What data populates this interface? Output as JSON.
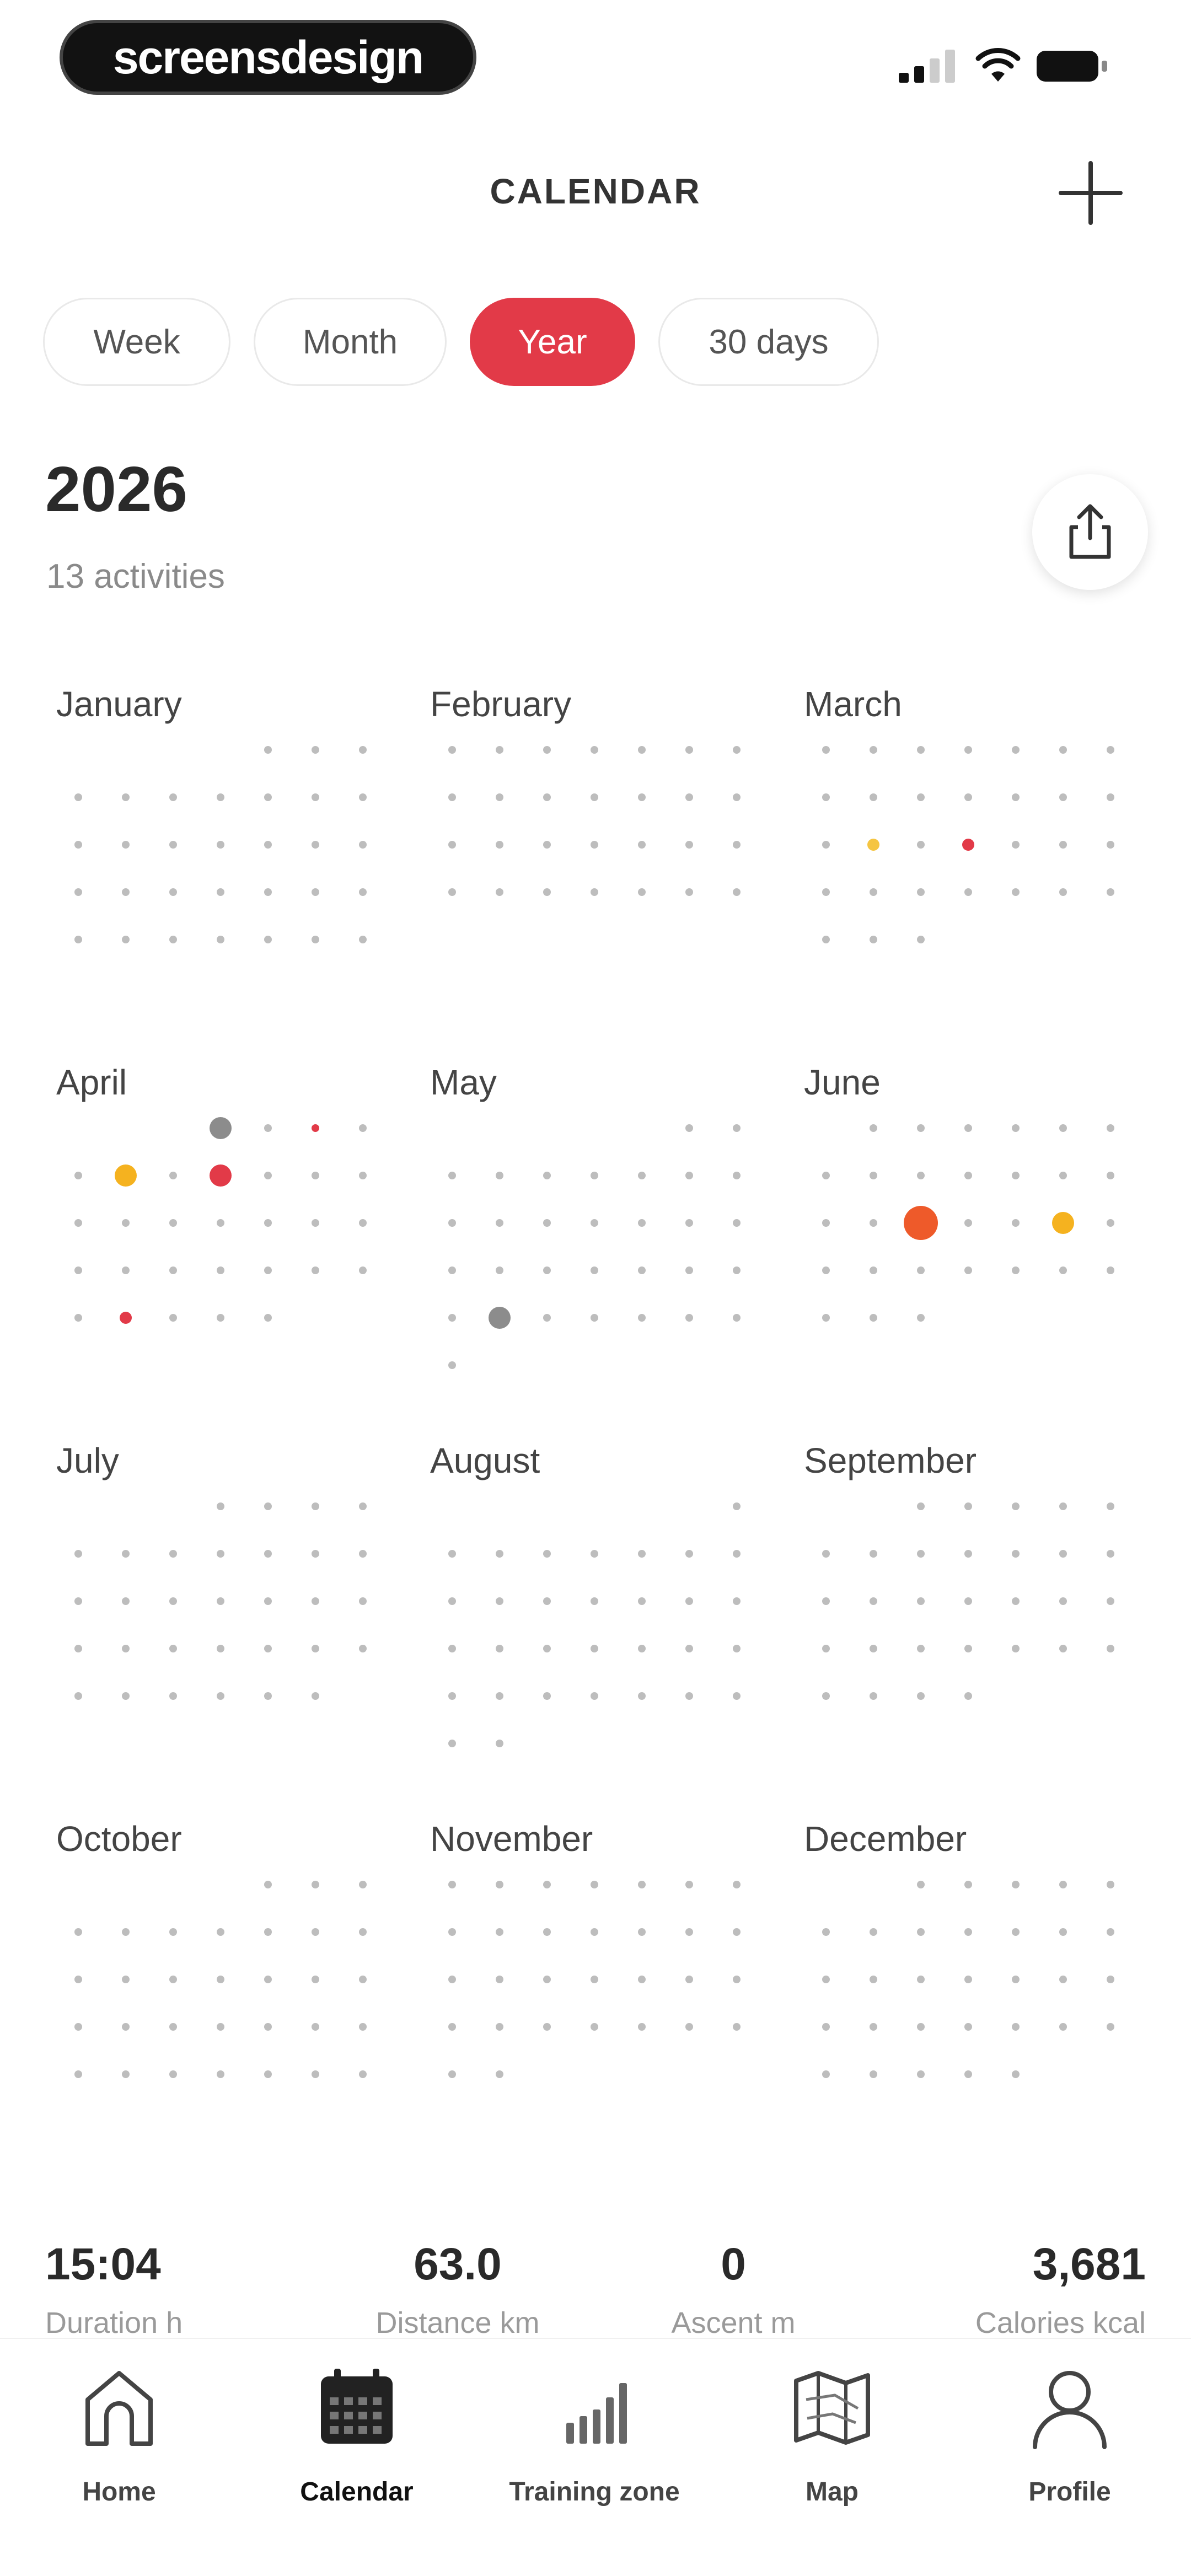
{
  "status_bar": {
    "brand": "screensdesign"
  },
  "header": {
    "title": "CALENDAR"
  },
  "tabs": [
    {
      "label": "Week",
      "active": false
    },
    {
      "label": "Month",
      "active": false
    },
    {
      "label": "Year",
      "active": true
    },
    {
      "label": "30 days",
      "active": false
    }
  ],
  "year": {
    "title": "2026",
    "activities": "13 activities"
  },
  "months": [
    {
      "name": "January",
      "days": 31,
      "offset": 4,
      "activities": []
    },
    {
      "name": "February",
      "days": 28,
      "offset": 0,
      "activities": []
    },
    {
      "name": "March",
      "days": 31,
      "offset": 0,
      "activities": [
        {
          "day": 16,
          "color": "#f5c542",
          "size": "small"
        },
        {
          "day": 18,
          "color": "#e23a48",
          "size": "small"
        }
      ]
    },
    {
      "name": "April",
      "days": 30,
      "offset": 3,
      "activities": [
        {
          "day": 1,
          "color": "#8c8c8c",
          "size": "medium"
        },
        {
          "day": 3,
          "color": "#e23a48",
          "size": "tiny"
        },
        {
          "day": 6,
          "color": "#f5b21f",
          "size": "medium"
        },
        {
          "day": 8,
          "color": "#e23a48",
          "size": "medium"
        },
        {
          "day": 27,
          "color": "#e23a48",
          "size": "small"
        }
      ]
    },
    {
      "name": "May",
      "days": 31,
      "offset": 5,
      "activities": [
        {
          "day": 25,
          "color": "#8c8c8c",
          "size": "medium"
        }
      ]
    },
    {
      "name": "June",
      "days": 30,
      "offset": 1,
      "activities": [
        {
          "day": 16,
          "color": "#ee5a2a",
          "size": "large"
        },
        {
          "day": 19,
          "color": "#f5b21f",
          "size": "medium"
        }
      ]
    },
    {
      "name": "July",
      "days": 31,
      "offset": 3,
      "activities": []
    },
    {
      "name": "August",
      "days": 31,
      "offset": 6,
      "activities": []
    },
    {
      "name": "September",
      "days": 30,
      "offset": 2,
      "activities": []
    },
    {
      "name": "October",
      "days": 31,
      "offset": 4,
      "activities": []
    },
    {
      "name": "November",
      "days": 30,
      "offset": 0,
      "activities": []
    },
    {
      "name": "December",
      "days": 31,
      "offset": 2,
      "activities": []
    }
  ],
  "stats": [
    {
      "value": "15:04",
      "label": "Duration h"
    },
    {
      "value": "63.0",
      "label": "Distance km"
    },
    {
      "value": "0",
      "label": "Ascent m"
    },
    {
      "value": "3,681",
      "label": "Calories kcal"
    }
  ],
  "nav": [
    {
      "label": "Home",
      "icon": "home-icon",
      "active": false
    },
    {
      "label": "Calendar",
      "icon": "calendar-icon",
      "active": true
    },
    {
      "label": "Training zone",
      "icon": "bar-chart-icon",
      "active": false
    },
    {
      "label": "Map",
      "icon": "map-icon",
      "active": false
    },
    {
      "label": "Profile",
      "icon": "profile-icon",
      "active": false
    }
  ],
  "colors": {
    "accent": "#e23a48",
    "dot": "#bdbdbd"
  }
}
